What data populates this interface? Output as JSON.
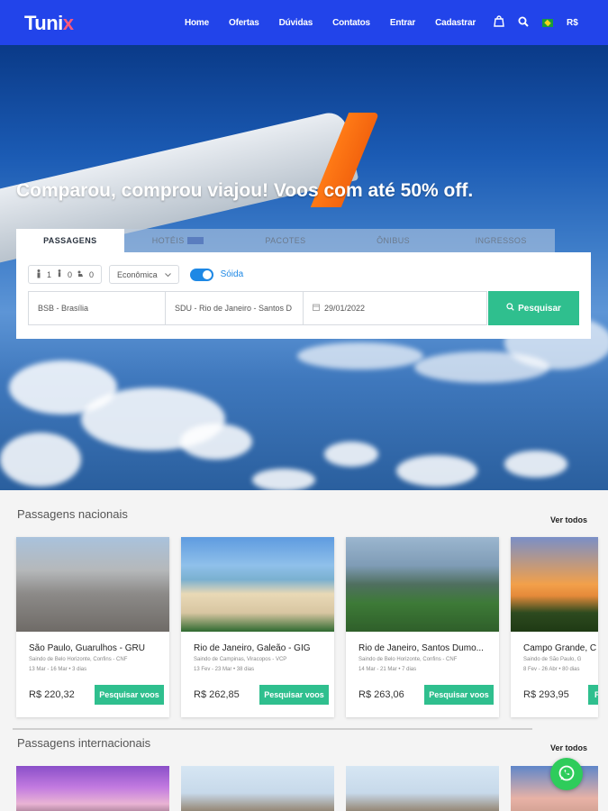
{
  "header": {
    "logo_main": "Tuni",
    "logo_accent": "x",
    "nav": [
      "Home",
      "Ofertas",
      "Dúvidas",
      "Contatos",
      "Entrar",
      "Cadastrar"
    ],
    "currency": "R$"
  },
  "hero": {
    "title": "Comparou, comprou viajou! Voos com até 50% off."
  },
  "search": {
    "tabs": [
      "PASSAGENS",
      "HOTÉIS",
      "PACOTES",
      "ÔNIBUS",
      "INGRESSOS"
    ],
    "active_tab": "PASSAGENS",
    "adults": "1",
    "children": "0",
    "infants": "0",
    "cabin_class": "Econômica",
    "trip_toggle_label": "Sóida",
    "origin": "BSB - Brasília",
    "destination": "SDU - Rio de Janeiro - Santos D",
    "date": "29/01/2022",
    "button_label": "Pesquisar"
  },
  "national": {
    "title": "Passagens nacionais",
    "see_all": "Ver todos",
    "cards": [
      {
        "title": "São Paulo, Guarulhos - GRU",
        "origin": "Saindo de Belo Horizonte, Confins - CNF",
        "dates": "13 Mar - 16 Mar • 3 dias",
        "price": "R$ 220,32",
        "button": "Pesquisar voos"
      },
      {
        "title": "Rio de Janeiro, Galeão - GIG",
        "origin": "Saindo de Campinas, Viracopos - VCP",
        "dates": "13 Fev - 23 Mar • 38 dias",
        "price": "R$ 262,85",
        "button": "Pesquisar voos"
      },
      {
        "title": "Rio de Janeiro, Santos Dumo...",
        "origin": "Saindo de Belo Horizonte, Confins - CNF",
        "dates": "14 Mar - 21 Mar • 7 dias",
        "price": "R$ 263,06",
        "button": "Pesquisar voos"
      },
      {
        "title": "Campo Grande, C",
        "origin": "Saindo de São Paulo, G",
        "dates": "8 Fev - 26 Abr • 80 dias",
        "price": "R$ 293,95",
        "button": "P"
      }
    ]
  },
  "international": {
    "title": "Passagens internacionais",
    "see_all": "Ver todos"
  }
}
